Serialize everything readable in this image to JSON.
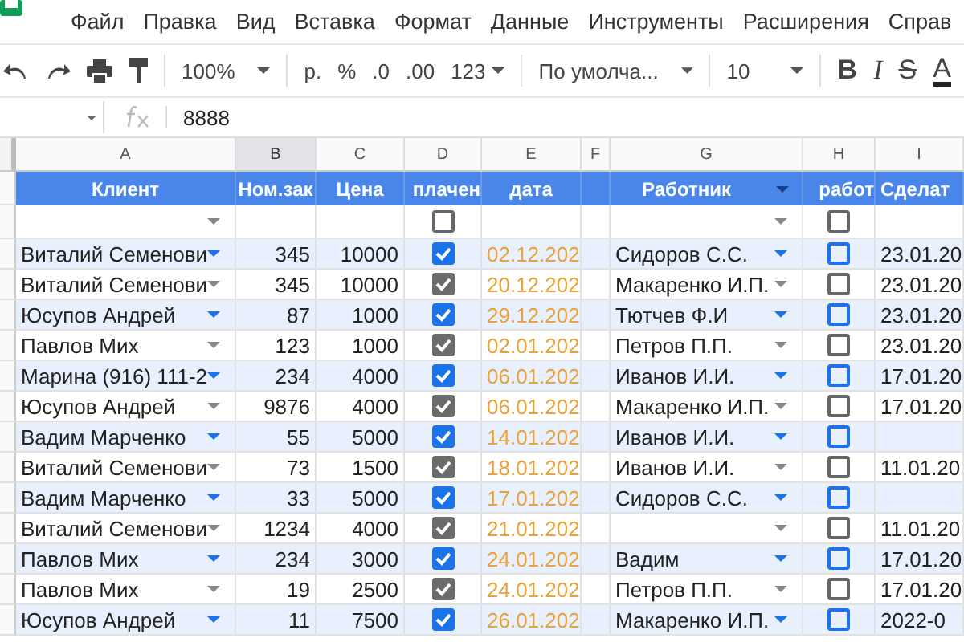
{
  "menu": [
    "Файл",
    "Правка",
    "Вид",
    "Вставка",
    "Формат",
    "Данные",
    "Инструменты",
    "Расширения",
    "Справ"
  ],
  "toolbar": {
    "zoom": "100%",
    "currency": "р.",
    "percent": "%",
    "decrease_decimals": ".0",
    "increase_decimals": ".00",
    "number_format": "123",
    "font": "По умолча...",
    "font_size": "10",
    "bold": "B",
    "italic": "I",
    "strikethrough": "S",
    "text_color": "A"
  },
  "formula_bar": {
    "value": "8888"
  },
  "columns": [
    {
      "label": "A",
      "selected": false
    },
    {
      "label": "B",
      "selected": true
    },
    {
      "label": "C",
      "selected": false
    },
    {
      "label": "D",
      "selected": false
    },
    {
      "label": "E",
      "selected": false
    },
    {
      "label": "F",
      "selected": false
    },
    {
      "label": "G",
      "selected": false
    },
    {
      "label": "H",
      "selected": false
    },
    {
      "label": "I",
      "selected": false
    }
  ],
  "header": {
    "client": "Клиент",
    "order": "Ном.зак",
    "price": "Цена",
    "paid": "плачен",
    "date": "дата",
    "worker": "Работник",
    "in_work": "работ",
    "done": "Сделат"
  },
  "filter_row": {
    "paid": false,
    "in_work": false
  },
  "rows": [
    {
      "client": "Виталий Семенови",
      "order": "345",
      "price": "10000",
      "paid": true,
      "date": "02.12.202",
      "worker": "Сидоров С.С.",
      "in_work": false,
      "done": "23.01.20"
    },
    {
      "client": "Виталий Семенови",
      "order": "345",
      "price": "10000",
      "paid": true,
      "date": "20.12.202",
      "worker": "Макаренко И.П.",
      "in_work": false,
      "done": "23.01.20"
    },
    {
      "client": "Юсупов Андрей",
      "order": "87",
      "price": "1000",
      "paid": true,
      "date": "29.12.202",
      "worker": "Тютчев Ф.И",
      "in_work": false,
      "done": "23.01.20"
    },
    {
      "client": "Павлов Мих",
      "order": "123",
      "price": "1000",
      "paid": true,
      "date": "02.01.202",
      "worker": "Петров П.П.",
      "in_work": false,
      "done": "23.01.20"
    },
    {
      "client": "Марина (916) 111-2",
      "order": "234",
      "price": "4000",
      "paid": true,
      "date": "06.01.202",
      "worker": "Иванов И.И.",
      "in_work": false,
      "done": "17.01.20"
    },
    {
      "client": "Юсупов Андрей",
      "order": "9876",
      "price": "4000",
      "paid": true,
      "date": "06.01.202",
      "worker": "Макаренко И.П.",
      "in_work": false,
      "done": "17.01.20"
    },
    {
      "client": "Вадим Марченко",
      "order": "55",
      "price": "5000",
      "paid": true,
      "date": "14.01.202",
      "worker": "Иванов И.И.",
      "in_work": false
    },
    {
      "client": "Виталий Семенови",
      "order": "73",
      "price": "1500",
      "paid": true,
      "date": "18.01.202",
      "worker": "Иванов И.И.",
      "in_work": false,
      "done": "11.01.20"
    },
    {
      "client": "Вадим Марченко",
      "order": "33",
      "price": "5000",
      "paid": true,
      "date": "17.01.202",
      "worker": "Сидоров С.С.",
      "in_work": false
    },
    {
      "client": "Виталий Семенови",
      "order": "1234",
      "price": "4000",
      "paid": true,
      "date": "21.01.202",
      "in_work": false,
      "done": "11.01.20"
    },
    {
      "client": "Павлов Мих",
      "order": "234",
      "price": "3000",
      "paid": true,
      "date": "24.01.202",
      "worker": "Вадим",
      "in_work": false,
      "done": "17.01.20"
    },
    {
      "client": "Павлов Мих",
      "order": "19",
      "price": "2500",
      "paid": true,
      "date": "24.01.202",
      "worker": "Петров П.П.",
      "in_work": false,
      "done": "17.01.20"
    },
    {
      "client": "Юсупов Андрей",
      "order": "11",
      "price": "7500",
      "paid": true,
      "date": "26.01.202",
      "worker": "Макаренко И.П.",
      "in_work": false,
      "done": "2022-0"
    }
  ]
}
